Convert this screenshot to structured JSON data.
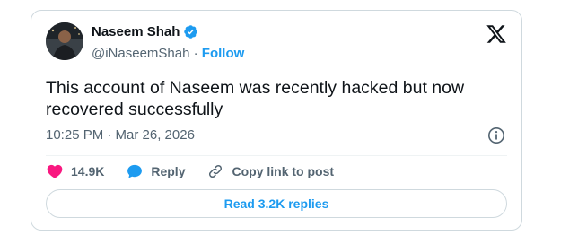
{
  "author": {
    "display_name": "Naseem Shah",
    "handle": "@iNaseemShah",
    "separator": " · ",
    "follow_label": "Follow",
    "verified": true
  },
  "icons": {
    "brand": "x-logo-icon",
    "verified": "verified-badge-icon",
    "info": "info-icon",
    "like": "heart-icon",
    "reply": "speech-bubble-icon",
    "copy_link": "link-icon"
  },
  "tweet": {
    "text": "This account of Naseem was recently hacked but now recovered successfully",
    "timestamp": "10:25 PM · Mar 26, 2026"
  },
  "actions": {
    "like_count": "14.9K",
    "reply_label": "Reply",
    "copy_link_label": "Copy link to post"
  },
  "read_replies_label": "Read 3.2K replies",
  "colors": {
    "accent": "#1d9bf0",
    "like": "#f91880",
    "text": "#0f1419",
    "muted": "#536471",
    "border": "#cfd9de"
  }
}
